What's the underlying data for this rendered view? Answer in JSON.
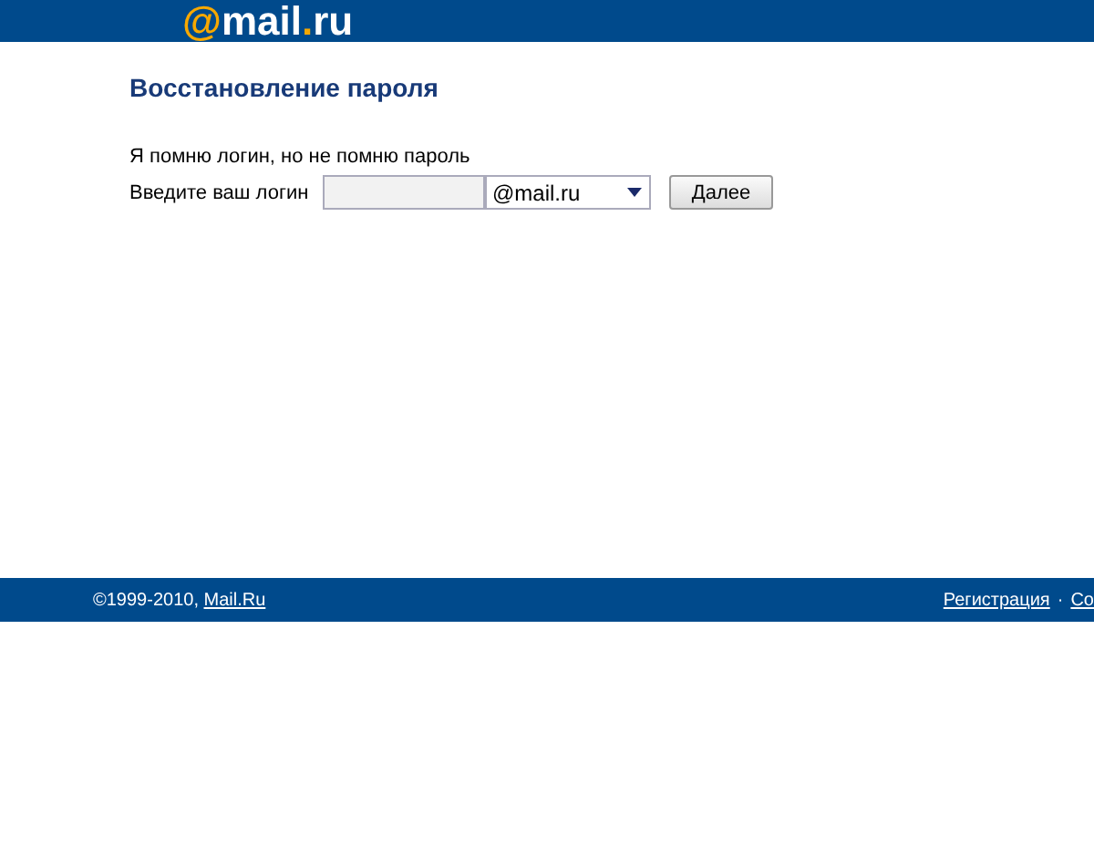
{
  "header": {
    "logo_at": "@",
    "logo_text": "mail",
    "logo_dot": ".",
    "logo_tld": "ru"
  },
  "title": "Восстановление пароля",
  "option": "Я помню логин, но не помню пароль",
  "form": {
    "label": "Введите ваш логин",
    "domain": "@mail.ru",
    "button": "Далее"
  },
  "footer": {
    "copyright": "©1999-2010, ",
    "copyright_link": "Mail.Ru",
    "links": [
      "Регистрация",
      "Со"
    ],
    "separator": "·"
  }
}
